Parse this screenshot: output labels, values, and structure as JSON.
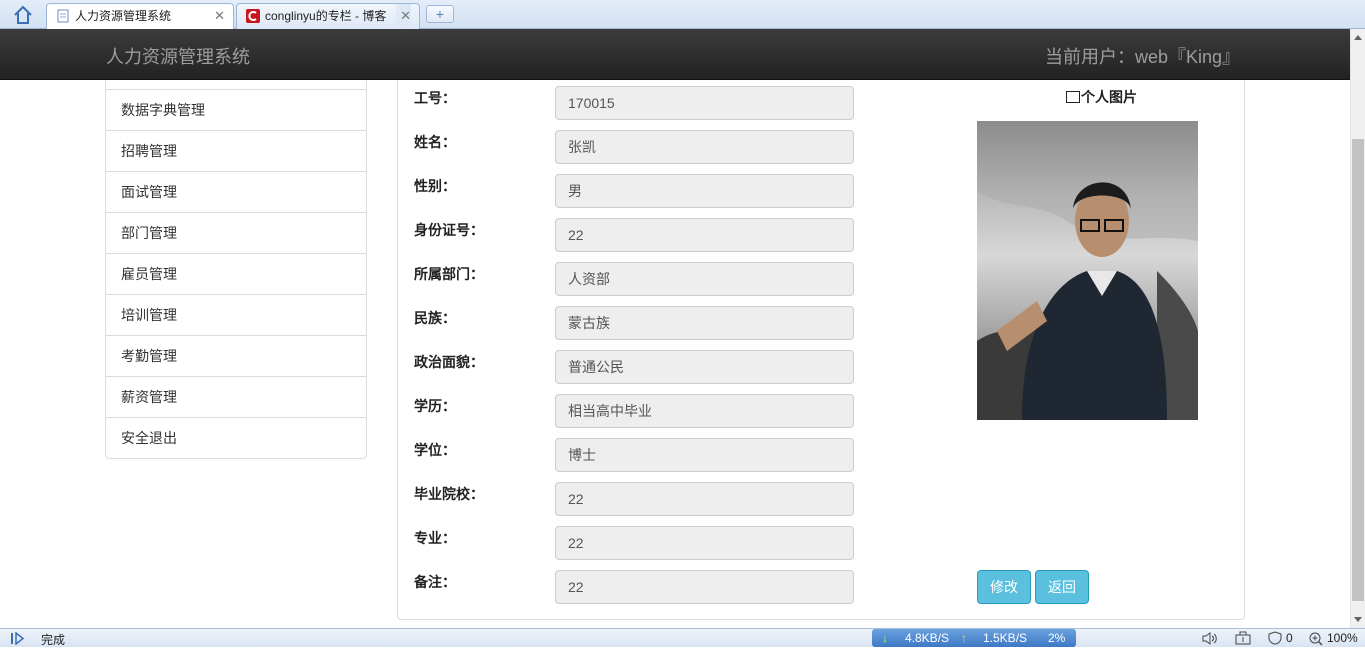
{
  "browser": {
    "tabs": [
      {
        "title": "人力资源管理系统",
        "active": true
      },
      {
        "title": "conglinyu的专栏 - 博客",
        "active": false
      }
    ],
    "new_tab_label": "+"
  },
  "navbar": {
    "brand": "人力资源管理系统",
    "current_user": "当前用户：web『King』"
  },
  "sidebar": {
    "items": [
      {
        "label": "数据字典管理"
      },
      {
        "label": "招聘管理"
      },
      {
        "label": "面试管理"
      },
      {
        "label": "部门管理"
      },
      {
        "label": "雇员管理"
      },
      {
        "label": "培训管理"
      },
      {
        "label": "考勤管理"
      },
      {
        "label": "薪资管理"
      },
      {
        "label": "安全退出"
      }
    ]
  },
  "form": {
    "fields": [
      {
        "label": "工号：",
        "value": "170015"
      },
      {
        "label": "姓名：",
        "value": "张凯"
      },
      {
        "label": "性别：",
        "value": "男"
      },
      {
        "label": "身份证号：",
        "value": "22"
      },
      {
        "label": "所属部门：",
        "value": "人资部"
      },
      {
        "label": "民族：",
        "value": "蒙古族"
      },
      {
        "label": "政治面貌：",
        "value": "普通公民"
      },
      {
        "label": "学历：",
        "value": "相当高中毕业"
      },
      {
        "label": "学位：",
        "value": "博士"
      },
      {
        "label": "毕业院校：",
        "value": "22"
      },
      {
        "label": "专业：",
        "value": "22"
      },
      {
        "label": "备注：",
        "value": "22"
      }
    ],
    "photo_title": "个人图片",
    "edit_button": "修改",
    "back_button": "返回"
  },
  "statusbar": {
    "status": "完成",
    "download_speed": "4.8KB/S",
    "upload_speed": "1.5KB/S",
    "cpu": "2%",
    "blocked_count": "0",
    "zoom": "100%"
  },
  "colors": {
    "navbar": "#222222",
    "button": "#5bc0de",
    "input_bg": "#eeeeee"
  }
}
